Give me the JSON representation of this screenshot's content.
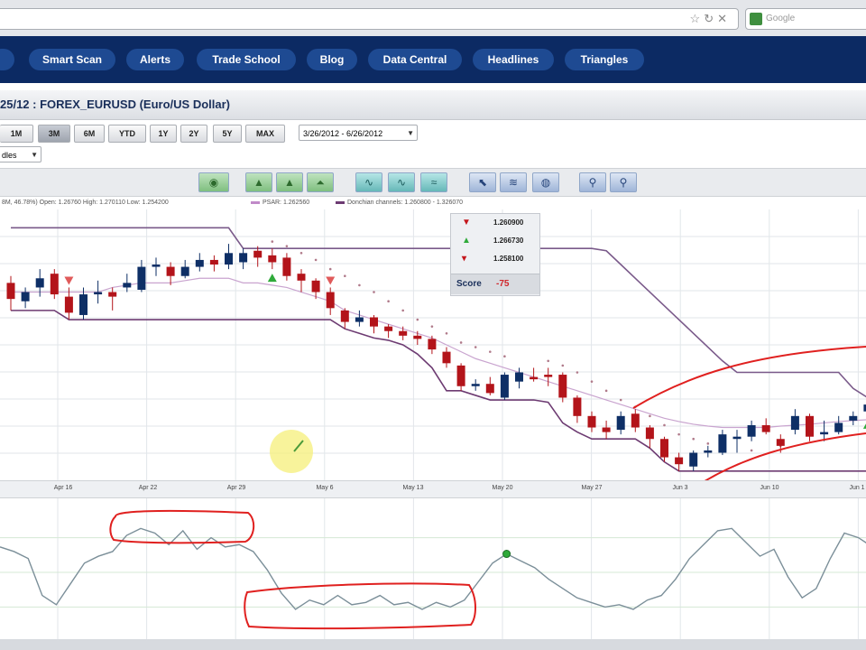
{
  "browser": {
    "search_placeholder": "Google",
    "icons": [
      "star-icon",
      "reload-icon",
      "stop-icon"
    ]
  },
  "nav": {
    "items": [
      {
        "label": "Smart Scan"
      },
      {
        "label": "Alerts"
      },
      {
        "label": "Trade School"
      },
      {
        "label": "Blog"
      },
      {
        "label": "Data Central"
      },
      {
        "label": "Headlines"
      },
      {
        "label": "Triangles"
      }
    ]
  },
  "chart_header": {
    "title": "25/12 : FOREX_EURUSD (Euro/US Dollar)"
  },
  "range_buttons": [
    "1M",
    "3M",
    "6M",
    "YTD",
    "1Y",
    "2Y",
    "5Y",
    "MAX"
  ],
  "active_range": "3M",
  "date_range": {
    "selected": "3/26/2012 - 6/26/2012"
  },
  "chart_type_select": {
    "selected": "dles"
  },
  "toolbar": {
    "icons": [
      "eye-icon",
      "indicator-a-icon",
      "indicator-b-icon",
      "indicator-c-icon",
      "line-chart-icon",
      "area-chart-icon",
      "wave-chart-icon",
      "cursor-icon",
      "draw-icon",
      "globe-icon",
      "zoom-in-icon",
      "zoom-out-icon"
    ]
  },
  "legend": {
    "ohlc_text": "8M, 46.78%)  Open: 1.26760  High: 1.270110  Low: 1.254200",
    "psar_text": "PSAR: 1.262560",
    "donchian_text": "Donchian channels: 1.260800 - 1.326070",
    "colors": {
      "psar": "#c08ac8",
      "donchian": "#6d3b72"
    }
  },
  "infobox": {
    "rows": [
      {
        "icon": "red-triangle-down-icon",
        "value": "1.260900"
      },
      {
        "icon": "green-triangle-up-icon",
        "value": "1.266730"
      },
      {
        "icon": "red-arrow-down-icon",
        "value": "1.258100"
      }
    ],
    "score_label": "Score",
    "score_value": "-75"
  },
  "x_axis": {
    "labels": [
      "Apr 16",
      "Apr 22",
      "Apr 29",
      "May 6",
      "May 13",
      "May 20",
      "May 27",
      "Jun 3",
      "Jun 10",
      "Jun 1"
    ]
  },
  "colors": {
    "nav_bg": "#0c2a63",
    "nav_pill": "#1e4a92",
    "up_candle": "#0e2f66",
    "down_candle": "#b3141a",
    "oscillator": "#7b8f99",
    "annotation": "#e0201f",
    "grid": "#e2e6ea",
    "signal_up": "#2faa3a"
  },
  "chart_data": {
    "type": "candlestick",
    "candles": [
      {
        "d": 1,
        "o": 1.317,
        "c": 1.3135,
        "h": 1.3185,
        "l": 1.311
      },
      {
        "d": 2,
        "o": 1.313,
        "c": 1.315,
        "h": 1.316,
        "l": 1.3115
      },
      {
        "d": 3,
        "o": 1.316,
        "c": 1.318,
        "h": 1.32,
        "l": 1.314
      },
      {
        "d": 4,
        "o": 1.319,
        "c": 1.3145,
        "h": 1.32,
        "l": 1.3135
      },
      {
        "d": 5,
        "o": 1.314,
        "c": 1.3105,
        "h": 1.316,
        "l": 1.309
      },
      {
        "d": 6,
        "o": 1.31,
        "c": 1.3145,
        "h": 1.316,
        "l": 1.309
      },
      {
        "d": 7,
        "o": 1.3145,
        "c": 1.315,
        "h": 1.3175,
        "l": 1.3125
      },
      {
        "d": 8,
        "o": 1.315,
        "c": 1.314,
        "h": 1.316,
        "l": 1.311
      },
      {
        "d": 9,
        "o": 1.316,
        "c": 1.317,
        "h": 1.319,
        "l": 1.315
      },
      {
        "d": 10,
        "o": 1.3155,
        "c": 1.3205,
        "h": 1.322,
        "l": 1.315
      },
      {
        "d": 11,
        "o": 1.3205,
        "c": 1.321,
        "h": 1.3225,
        "l": 1.3185
      },
      {
        "d": 12,
        "o": 1.3205,
        "c": 1.3185,
        "h": 1.3215,
        "l": 1.3165
      },
      {
        "d": 13,
        "o": 1.3185,
        "c": 1.3205,
        "h": 1.322,
        "l": 1.318
      },
      {
        "d": 14,
        "o": 1.3205,
        "c": 1.322,
        "h": 1.3235,
        "l": 1.3195
      },
      {
        "d": 15,
        "o": 1.322,
        "c": 1.321,
        "h": 1.323,
        "l": 1.3195
      },
      {
        "d": 16,
        "o": 1.321,
        "c": 1.3235,
        "h": 1.3255,
        "l": 1.32
      },
      {
        "d": 17,
        "o": 1.3215,
        "c": 1.3235,
        "h": 1.3245,
        "l": 1.32
      },
      {
        "d": 18,
        "o": 1.324,
        "c": 1.3225,
        "h": 1.325,
        "l": 1.3205
      },
      {
        "d": 19,
        "o": 1.323,
        "c": 1.3215,
        "h": 1.3245,
        "l": 1.32
      },
      {
        "d": 20,
        "o": 1.3225,
        "c": 1.3185,
        "h": 1.3235,
        "l": 1.3175
      },
      {
        "d": 21,
        "o": 1.319,
        "c": 1.3175,
        "h": 1.32,
        "l": 1.315
      },
      {
        "d": 22,
        "o": 1.3175,
        "c": 1.315,
        "h": 1.318,
        "l": 1.3135
      },
      {
        "d": 23,
        "o": 1.315,
        "c": 1.3115,
        "h": 1.316,
        "l": 1.31
      },
      {
        "d": 24,
        "o": 1.311,
        "c": 1.3085,
        "h": 1.3115,
        "l": 1.307
      },
      {
        "d": 25,
        "o": 1.3085,
        "c": 1.3095,
        "h": 1.311,
        "l": 1.3075
      },
      {
        "d": 26,
        "o": 1.3095,
        "c": 1.3075,
        "h": 1.31,
        "l": 1.306
      },
      {
        "d": 27,
        "o": 1.3075,
        "c": 1.3065,
        "h": 1.308,
        "l": 1.305
      },
      {
        "d": 28,
        "o": 1.3065,
        "c": 1.3055,
        "h": 1.3075,
        "l": 1.3045
      },
      {
        "d": 29,
        "o": 1.3055,
        "c": 1.3048,
        "h": 1.3065,
        "l": 1.3035
      },
      {
        "d": 30,
        "o": 1.3048,
        "c": 1.3025,
        "h": 1.3055,
        "l": 1.3015
      },
      {
        "d": 31,
        "o": 1.302,
        "c": 1.2995,
        "h": 1.303,
        "l": 1.2985
      },
      {
        "d": 32,
        "o": 1.299,
        "c": 1.2945,
        "h": 1.2995,
        "l": 1.2935
      },
      {
        "d": 33,
        "o": 1.2945,
        "c": 1.295,
        "h": 1.296,
        "l": 1.2935
      },
      {
        "d": 34,
        "o": 1.295,
        "c": 1.293,
        "h": 1.2965,
        "l": 1.2925
      },
      {
        "d": 35,
        "o": 1.292,
        "c": 1.297,
        "h": 1.2975,
        "l": 1.2915
      },
      {
        "d": 36,
        "o": 1.2955,
        "c": 1.2975,
        "h": 1.2985,
        "l": 1.294
      },
      {
        "d": 37,
        "o": 1.2965,
        "c": 1.296,
        "h": 1.2985,
        "l": 1.2955
      },
      {
        "d": 38,
        "o": 1.297,
        "c": 1.2965,
        "h": 1.2985,
        "l": 1.2945
      },
      {
        "d": 39,
        "o": 1.297,
        "c": 1.292,
        "h": 1.2975,
        "l": 1.291
      },
      {
        "d": 40,
        "o": 1.292,
        "c": 1.288,
        "h": 1.2925,
        "l": 1.2865
      },
      {
        "d": 41,
        "o": 1.288,
        "c": 1.2855,
        "h": 1.289,
        "l": 1.2845
      },
      {
        "d": 42,
        "o": 1.2855,
        "c": 1.2845,
        "h": 1.287,
        "l": 1.283
      },
      {
        "d": 43,
        "o": 1.285,
        "c": 1.288,
        "h": 1.289,
        "l": 1.284
      },
      {
        "d": 44,
        "o": 1.2885,
        "c": 1.2855,
        "h": 1.2895,
        "l": 1.2845
      },
      {
        "d": 45,
        "o": 1.2855,
        "c": 1.283,
        "h": 1.286,
        "l": 1.281
      },
      {
        "d": 46,
        "o": 1.283,
        "c": 1.279,
        "h": 1.2835,
        "l": 1.278
      },
      {
        "d": 47,
        "o": 1.279,
        "c": 1.2775,
        "h": 1.28,
        "l": 1.276
      },
      {
        "d": 48,
        "o": 1.277,
        "c": 1.28,
        "h": 1.2805,
        "l": 1.276
      },
      {
        "d": 49,
        "o": 1.28,
        "c": 1.2805,
        "h": 1.2815,
        "l": 1.279
      },
      {
        "d": 50,
        "o": 1.28,
        "c": 1.284,
        "h": 1.285,
        "l": 1.2795
      },
      {
        "d": 51,
        "o": 1.283,
        "c": 1.2835,
        "h": 1.285,
        "l": 1.28
      },
      {
        "d": 52,
        "o": 1.2835,
        "c": 1.286,
        "h": 1.287,
        "l": 1.2825
      },
      {
        "d": 53,
        "o": 1.286,
        "c": 1.2845,
        "h": 1.2875,
        "l": 1.284
      },
      {
        "d": 54,
        "o": 1.283,
        "c": 1.2815,
        "h": 1.284,
        "l": 1.28
      },
      {
        "d": 55,
        "o": 1.285,
        "c": 1.288,
        "h": 1.2895,
        "l": 1.284
      },
      {
        "d": 56,
        "o": 1.288,
        "c": 1.2835,
        "h": 1.2885,
        "l": 1.2825
      },
      {
        "d": 57,
        "o": 1.284,
        "c": 1.2845,
        "h": 1.287,
        "l": 1.2825
      },
      {
        "d": 58,
        "o": 1.2845,
        "c": 1.2865,
        "h": 1.288,
        "l": 1.284
      },
      {
        "d": 59,
        "o": 1.287,
        "c": 1.288,
        "h": 1.289,
        "l": 1.286
      },
      {
        "d": 60,
        "o": 1.289,
        "c": 1.2905,
        "h": 1.292,
        "l": 1.288
      }
    ],
    "donchian_upper": [
      1.329,
      1.329,
      1.329,
      1.329,
      1.329,
      1.329,
      1.329,
      1.329,
      1.329,
      1.329,
      1.329,
      1.329,
      1.329,
      1.329,
      1.329,
      1.329,
      1.3245,
      1.3245,
      1.3245,
      1.3245,
      1.3245,
      1.3245,
      1.3245,
      1.3245,
      1.3245,
      1.3245,
      1.3245,
      1.3245,
      1.3245,
      1.3245,
      1.3245,
      1.3245,
      1.3245,
      1.3245,
      1.3245,
      1.3245,
      1.3245,
      1.3245,
      1.3245,
      1.3245,
      1.3245,
      1.324,
      1.321,
      1.318,
      1.315,
      1.312,
      1.309,
      1.306,
      1.303,
      1.3,
      1.2975,
      1.2975,
      1.2975,
      1.2975,
      1.2975,
      1.2975,
      1.2975,
      1.2975,
      1.294,
      1.292
    ],
    "donchian_lower": [
      1.311,
      1.311,
      1.311,
      1.311,
      1.309,
      1.309,
      1.309,
      1.309,
      1.309,
      1.309,
      1.309,
      1.309,
      1.309,
      1.309,
      1.309,
      1.309,
      1.309,
      1.309,
      1.309,
      1.309,
      1.309,
      1.309,
      1.309,
      1.307,
      1.306,
      1.305,
      1.3045,
      1.3035,
      1.3015,
      1.2985,
      1.2935,
      1.2935,
      1.2925,
      1.2915,
      1.2915,
      1.2915,
      1.2915,
      1.291,
      1.2865,
      1.2845,
      1.283,
      1.283,
      1.283,
      1.283,
      1.281,
      1.278,
      1.276,
      1.276,
      1.276,
      1.276,
      1.276,
      1.276,
      1.276,
      1.276,
      1.276,
      1.276,
      1.276,
      1.276,
      1.276,
      1.276
    ],
    "middle_line": [
      1.315,
      1.315,
      1.315,
      1.315,
      1.315,
      1.315,
      1.315,
      1.316,
      1.3165,
      1.317,
      1.317,
      1.317,
      1.3175,
      1.318,
      1.318,
      1.318,
      1.317,
      1.317,
      1.3165,
      1.316,
      1.315,
      1.314,
      1.313,
      1.311,
      1.31,
      1.309,
      1.308,
      1.307,
      1.306,
      1.305,
      1.3035,
      1.302,
      1.3005,
      1.2995,
      1.2985,
      1.2975,
      1.2965,
      1.2955,
      1.2945,
      1.2935,
      1.2925,
      1.2915,
      1.2905,
      1.2895,
      1.2885,
      1.2875,
      1.2868,
      1.2862,
      1.2858,
      1.2855,
      1.2855,
      1.2855,
      1.2855,
      1.2858,
      1.286,
      1.2862,
      1.2865,
      1.2868,
      1.287,
      1.2872
    ],
    "psar_dots": [
      [
        19,
        1.326
      ],
      [
        20,
        1.325
      ],
      [
        21,
        1.3235
      ],
      [
        22,
        1.322
      ],
      [
        23,
        1.32
      ],
      [
        24,
        1.3185
      ],
      [
        25,
        1.3165
      ],
      [
        26,
        1.315
      ],
      [
        27,
        1.313
      ],
      [
        28,
        1.311
      ],
      [
        29,
        1.309
      ],
      [
        30,
        1.3075
      ],
      [
        31,
        1.306
      ],
      [
        32,
        1.304
      ],
      [
        33,
        1.303
      ],
      [
        34,
        1.302
      ],
      [
        35,
        1.301
      ],
      [
        38,
        1.3
      ],
      [
        39,
        1.299
      ],
      [
        40,
        1.2975
      ],
      [
        41,
        1.2955
      ],
      [
        42,
        1.2935
      ],
      [
        43,
        1.2915
      ],
      [
        44,
        1.29
      ],
      [
        45,
        1.288
      ],
      [
        46,
        1.286
      ],
      [
        47,
        1.284
      ],
      [
        48,
        1.283
      ],
      [
        49,
        1.282
      ],
      [
        50,
        1.2815
      ],
      [
        52,
        1.2805
      ],
      [
        54,
        1.2815
      ]
    ],
    "signals": [
      {
        "d": 5,
        "kind": "sell"
      },
      {
        "d": 19,
        "kind": "buy"
      },
      {
        "d": 23,
        "kind": "sell"
      },
      {
        "d": 60,
        "kind": "buy"
      }
    ],
    "y_range": [
      1.274,
      1.333
    ],
    "x_labels": [
      "Apr 16",
      "Apr 22",
      "Apr 29",
      "May 6",
      "May 13",
      "May 20",
      "May 27",
      "Jun 3",
      "Jun 10",
      "Jun 1"
    ],
    "oscillator": {
      "values": [
        72,
        68,
        62,
        30,
        22,
        40,
        58,
        64,
        68,
        82,
        88,
        84,
        74,
        86,
        70,
        80,
        72,
        74,
        68,
        52,
        32,
        18,
        26,
        22,
        30,
        22,
        24,
        30,
        22,
        24,
        18,
        24,
        20,
        26,
        42,
        58,
        66,
        60,
        54,
        44,
        36,
        28,
        24,
        20,
        22,
        18,
        26,
        30,
        44,
        62,
        74,
        86,
        88,
        76,
        64,
        70,
        46,
        28,
        36,
        62,
        84,
        80,
        72
      ],
      "y_range": [
        0,
        100
      ],
      "signal_point": 36
    }
  }
}
